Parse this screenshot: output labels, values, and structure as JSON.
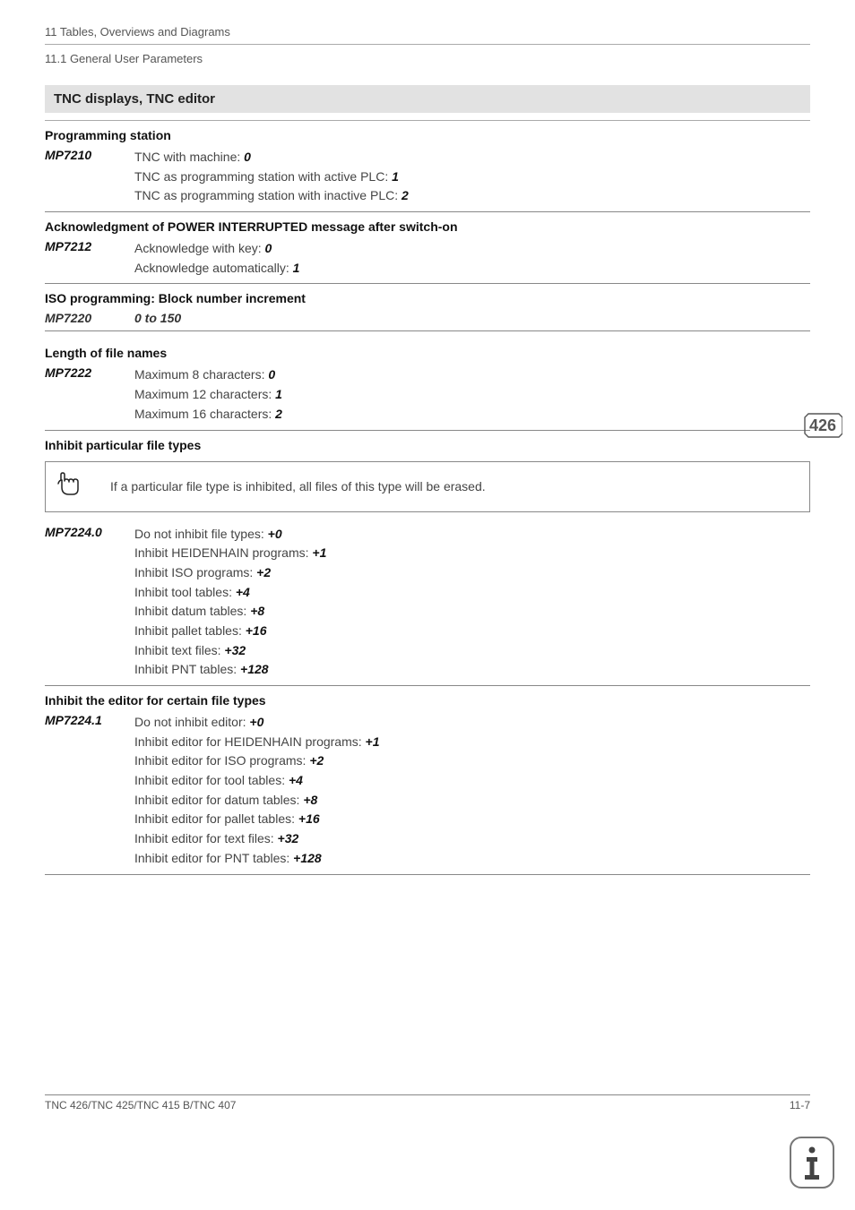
{
  "header": {
    "chapter": "11   Tables, Overviews and Diagrams",
    "section": "11.1 General User Parameters"
  },
  "title": "TNC displays, TNC editor",
  "groups": {
    "programming_station": {
      "heading": "Programming station",
      "code": "MP7210",
      "lines": [
        {
          "text": "TNC with machine: ",
          "val": "0"
        },
        {
          "text": "TNC as programming station with active PLC: ",
          "val": "1"
        },
        {
          "text": "TNC as programming station with inactive PLC: ",
          "val": "2"
        }
      ]
    },
    "ack_power": {
      "heading": "Acknowledgment of POWER INTERRUPTED message after switch-on",
      "code": "MP7212",
      "lines": [
        {
          "text": "Acknowledge with key: ",
          "val": "0"
        },
        {
          "text": "Acknowledge automatically: ",
          "val": "1"
        }
      ]
    },
    "iso_block": {
      "heading": "ISO programming: Block number increment",
      "code": "MP7220",
      "range": "0 to 150"
    },
    "file_names": {
      "heading": "Length of file names",
      "code": "MP7222",
      "lines": [
        {
          "text": "Maximum 8 characters: ",
          "val": "0"
        },
        {
          "text": "Maximum 12 characters: ",
          "val": "1"
        },
        {
          "text": "Maximum 16 characters: ",
          "val": "2"
        }
      ]
    },
    "inhibit_types": {
      "heading": "Inhibit particular file types",
      "info": "If a particular file type is inhibited, all files of this type will be erased.",
      "code": "MP7224.0",
      "lines": [
        {
          "text": "Do not inhibit file types: ",
          "val": "+0"
        },
        {
          "text": "Inhibit HEIDENHAIN programs: ",
          "val": "+1"
        },
        {
          "text": "Inhibit ISO programs: ",
          "val": "+2"
        },
        {
          "text": "Inhibit tool tables: ",
          "val": "+4"
        },
        {
          "text": "Inhibit datum tables: ",
          "val": "+8"
        },
        {
          "text": "Inhibit pallet tables: ",
          "val": "+16"
        },
        {
          "text": "Inhibit text files: ",
          "val": "+32"
        },
        {
          "text": "Inhibit PNT tables: ",
          "val": "+128"
        }
      ]
    },
    "inhibit_editor": {
      "heading": "Inhibit the editor for certain file types",
      "code": "MP7224.1",
      "lines": [
        {
          "text": "Do not inhibit editor: ",
          "val": "+0"
        },
        {
          "text": "Inhibit editor for HEIDENHAIN programs: ",
          "val": "+1"
        },
        {
          "text": "Inhibit editor for ISO programs: ",
          "val": "+2"
        },
        {
          "text": "Inhibit editor for tool tables: ",
          "val": "+4"
        },
        {
          "text": "Inhibit editor for datum tables: ",
          "val": "+8"
        },
        {
          "text": "Inhibit editor for pallet tables: ",
          "val": "+16"
        },
        {
          "text": "Inhibit editor for text files: ",
          "val": "+32"
        },
        {
          "text": "Inhibit editor for PNT tables: ",
          "val": "+128"
        }
      ]
    }
  },
  "badge426": "426",
  "footer": {
    "left": "TNC 426/TNC 425/TNC 415 B/TNC 407",
    "right": "11-7"
  }
}
